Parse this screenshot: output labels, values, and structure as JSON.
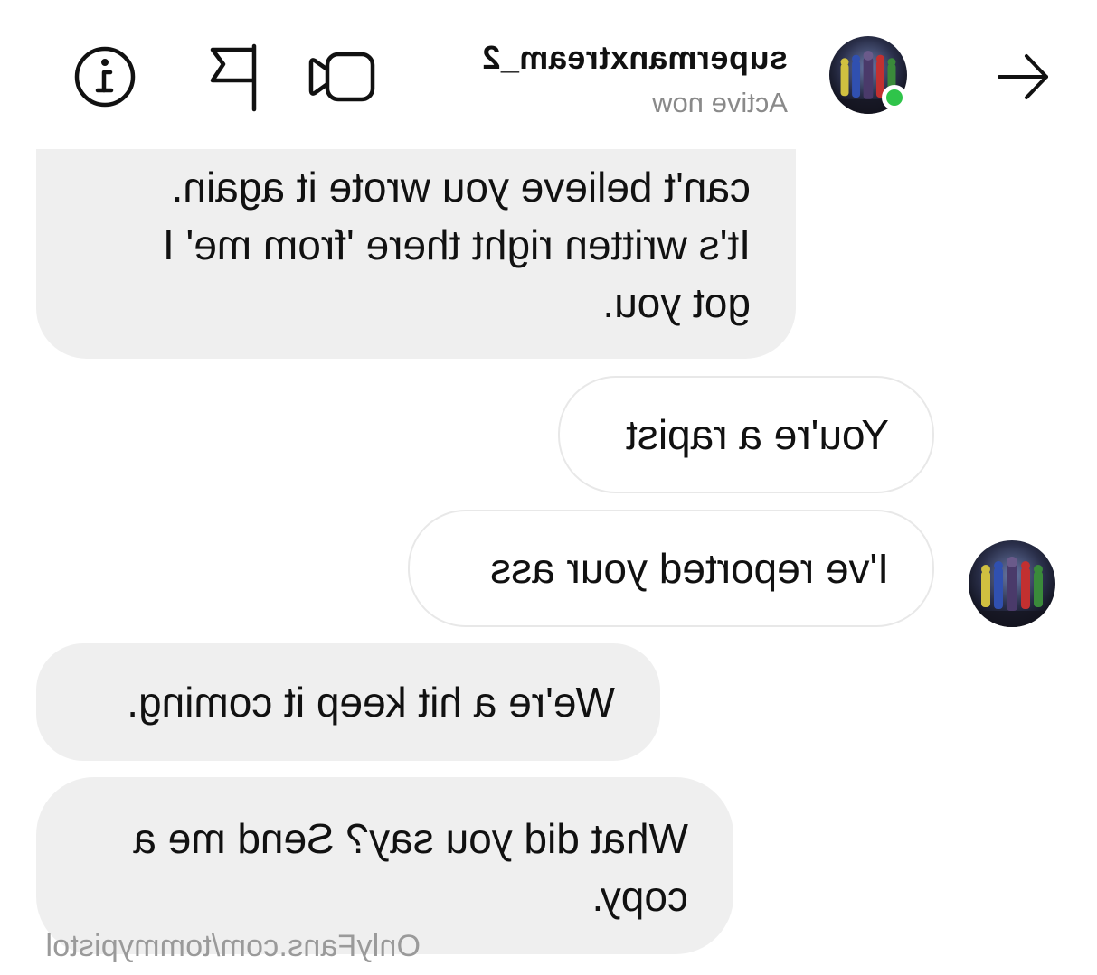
{
  "header": {
    "username": "supermanxtream_2",
    "presence": "Active now",
    "icons": {
      "back": "arrow-left-icon",
      "video": "video-call-icon",
      "flag": "flag-icon",
      "info": "info-icon"
    },
    "colors": {
      "online": "#2fc44a"
    }
  },
  "messages": [
    {
      "direction": "incoming",
      "lines": [
        "got you.",
        "It's written right there 'from me' I",
        "can't believe you wrote it again."
      ]
    },
    {
      "direction": "outgoing",
      "text": "You're a rapist"
    },
    {
      "direction": "outgoing",
      "text": "I've reported your ass"
    },
    {
      "direction": "incoming",
      "text": "We're a hit keep it coming."
    },
    {
      "direction": "incoming",
      "lines": [
        "What did you say? Send me a",
        "copy."
      ]
    }
  ],
  "watermark": "OnlyFans.com/tommypistol",
  "colors": {
    "incoming_bubble": "#efefef",
    "outgoing_border": "#e8e8e8",
    "secondary_text": "#8a8a8a"
  }
}
